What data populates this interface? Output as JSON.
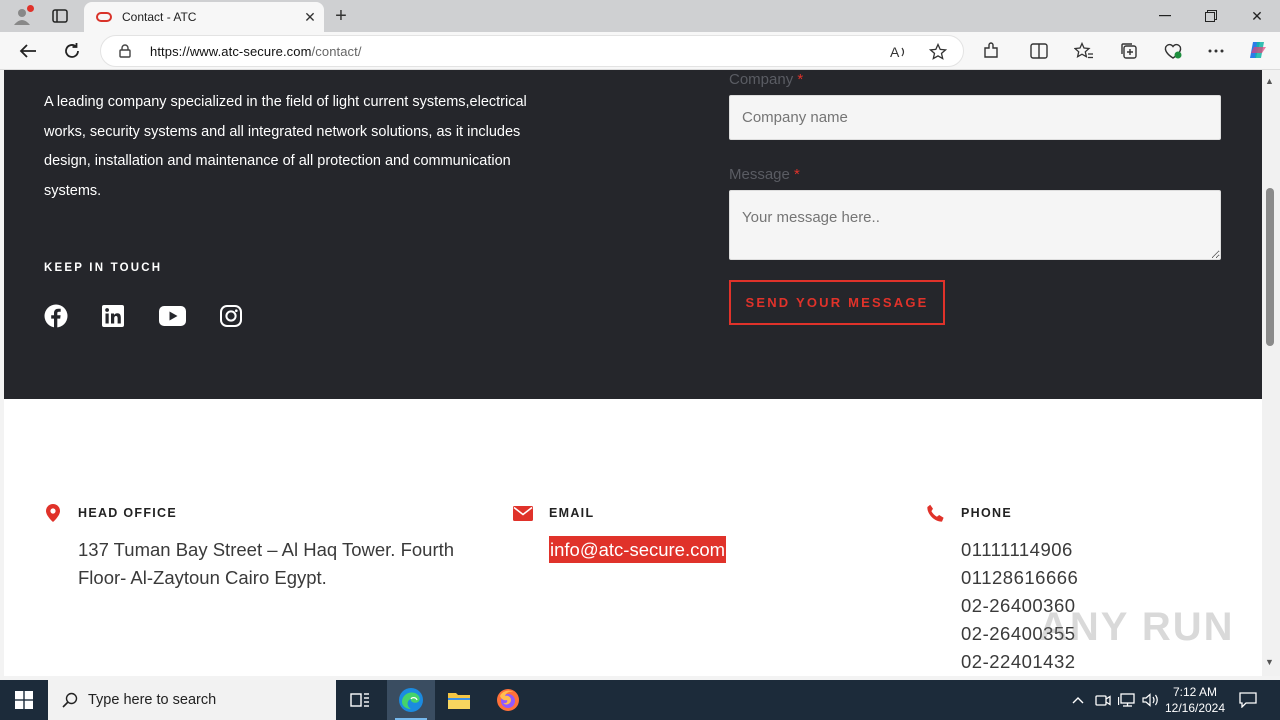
{
  "browser": {
    "tab_title": "Contact - ATC",
    "url_host": "https://www.atc-secure.com",
    "url_path": "/contact/"
  },
  "about": {
    "text": "A leading company specialized in the field of light current systems,electrical works, security systems and all integrated network solutions, as it includes design, installation and maintenance of all protection and communication systems."
  },
  "keep_in_touch": "KEEP IN TOUCH",
  "social": [
    "facebook-icon",
    "linkedin-icon",
    "youtube-icon",
    "instagram-icon"
  ],
  "form": {
    "company_label": "Company",
    "company_placeholder": "Company name",
    "message_label": "Message",
    "message_placeholder": "Your message here..",
    "required_mark": "*",
    "send_label": "SEND YOUR MESSAGE"
  },
  "contact": {
    "office_title": "HEAD OFFICE",
    "office_address": "137 Tuman Bay Street – Al Haq Tower. Fourth Floor- Al-Zaytoun Cairo Egypt.",
    "email_title": "EMAIL",
    "email": "info@atc-secure.com",
    "phone_title": "PHONE",
    "phones": [
      "01111114906",
      "01128616666",
      "02-26400360",
      "02-26400355",
      "02-22401432"
    ]
  },
  "watermark": "ANY RUN",
  "taskbar": {
    "search_placeholder": "Type here to search",
    "time": "7:12 AM",
    "date": "12/16/2024"
  },
  "colors": {
    "accent": "#e0322a",
    "dark_bg": "#25262b",
    "taskbar": "#1c2b3a"
  }
}
